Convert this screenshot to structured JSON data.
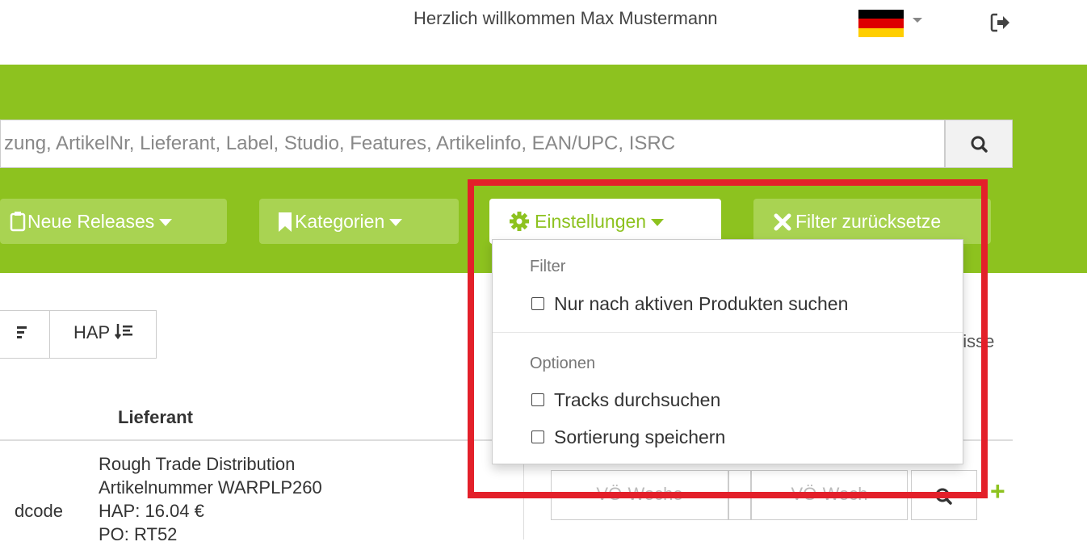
{
  "header": {
    "welcome": "Herzlich willkommen Max Mustermann",
    "language_flag": "de-flag-icon",
    "logout_icon": "logout-icon"
  },
  "colors": {
    "brand_green": "#8dc21f",
    "highlight_red": "#e3202a"
  },
  "search": {
    "placeholder": "zung, ArtikelNr, Lieferant, Label, Studio, Features, Artikelinfo, EAN/UPC, ISRC",
    "button_icon": "search-icon"
  },
  "nav": {
    "new_releases": "Neue Releases",
    "categories": "Kategorien",
    "settings": "Einstellungen",
    "reset_filter": "Filter zurücksetze"
  },
  "settings_menu": {
    "filter_header": "Filter",
    "active_products": "Nur nach aktiven Produkten suchen",
    "options_header": "Optionen",
    "search_tracks": "Tracks durchsuchen",
    "save_sort": "Sortierung speichern"
  },
  "sort": {
    "hap_label": "HAP"
  },
  "results": {
    "label_partial": "nisse",
    "column_supplier": "Lieferant",
    "row": {
      "supplier": "Rough Trade Distribution",
      "article_number": "Artikelnummer WARPLP260",
      "hap": "HAP: 16.04 €",
      "extra": "PO: RT52",
      "left_partial": "dcode",
      "release_week_from": "VÖ-Woche",
      "release_week_to": "VÖ-Woch"
    }
  }
}
